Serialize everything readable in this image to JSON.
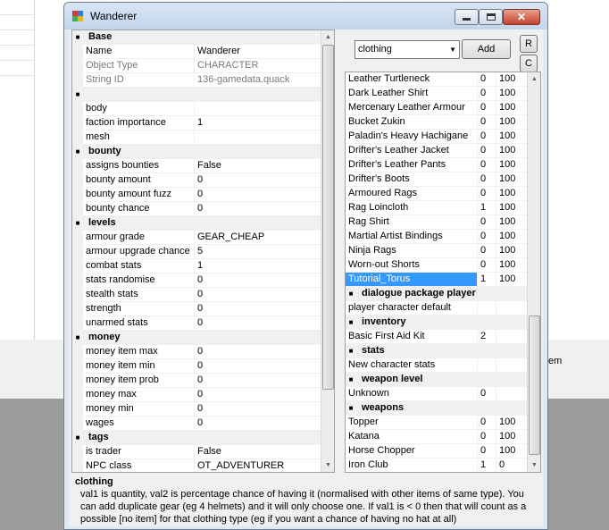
{
  "background": {
    "side_label": "em"
  },
  "window": {
    "title": "Wanderer"
  },
  "colors": {
    "title_bar": "#c3d5ec",
    "selection": "#3399ff",
    "category_bg": "#f0f0f0",
    "close_button": "#c3442e"
  },
  "properties": [
    {
      "cat": "Base"
    },
    {
      "k": "Name",
      "v": "Wanderer"
    },
    {
      "k": "Object Type",
      "v": "CHARACTER",
      "ro": true
    },
    {
      "k": "String ID",
      "v": "136-gamedata.quack",
      "ro": true
    },
    {
      "cat": ""
    },
    {
      "k": "body",
      "v": ""
    },
    {
      "k": "faction importance",
      "v": "1"
    },
    {
      "k": "mesh",
      "v": ""
    },
    {
      "cat": "bounty"
    },
    {
      "k": "assigns bounties",
      "v": "False"
    },
    {
      "k": "bounty amount",
      "v": "0"
    },
    {
      "k": "bounty amount fuzz",
      "v": "0"
    },
    {
      "k": "bounty chance",
      "v": "0"
    },
    {
      "cat": "levels"
    },
    {
      "k": "armour grade",
      "v": "GEAR_CHEAP"
    },
    {
      "k": "armour upgrade chance",
      "v": "5"
    },
    {
      "k": "combat stats",
      "v": "1"
    },
    {
      "k": "stats randomise",
      "v": "0"
    },
    {
      "k": "stealth stats",
      "v": "0"
    },
    {
      "k": "strength",
      "v": "0"
    },
    {
      "k": "unarmed stats",
      "v": "0"
    },
    {
      "cat": "money"
    },
    {
      "k": "money item max",
      "v": "0"
    },
    {
      "k": "money item min",
      "v": "0"
    },
    {
      "k": "money item prob",
      "v": "0"
    },
    {
      "k": "money max",
      "v": "0"
    },
    {
      "k": "money min",
      "v": "0"
    },
    {
      "k": "wages",
      "v": "0"
    },
    {
      "cat": "tags"
    },
    {
      "k": "is trader",
      "v": "False"
    },
    {
      "k": "NPC class",
      "v": "OT_ADVENTURER"
    }
  ],
  "references": {
    "category_select": "clothing",
    "add_label": "Add",
    "r_label": "R",
    "c_label": "C",
    "rows": [
      {
        "k": "Leather Turtleneck",
        "a": "0",
        "b": "100"
      },
      {
        "k": "Dark Leather Shirt",
        "a": "0",
        "b": "100"
      },
      {
        "k": "Mercenary Leather Armour",
        "a": "0",
        "b": "100"
      },
      {
        "k": "Bucket Zukin",
        "a": "0",
        "b": "100"
      },
      {
        "k": "Paladin's Heavy Hachigane",
        "a": "0",
        "b": "100"
      },
      {
        "k": "Drifter's Leather Jacket",
        "a": "0",
        "b": "100"
      },
      {
        "k": "Drifter's Leather Pants",
        "a": "0",
        "b": "100"
      },
      {
        "k": "Drifter's Boots",
        "a": "0",
        "b": "100"
      },
      {
        "k": "Armoured Rags",
        "a": "0",
        "b": "100"
      },
      {
        "k": "Rag Loincloth",
        "a": "1",
        "b": "100"
      },
      {
        "k": "Rag Shirt",
        "a": "0",
        "b": "100"
      },
      {
        "k": "Martial Artist Bindings",
        "a": "0",
        "b": "100"
      },
      {
        "k": "Ninja Rags",
        "a": "0",
        "b": "100"
      },
      {
        "k": "Worn-out Shorts",
        "a": "0",
        "b": "100"
      },
      {
        "k": "Tutorial_Torus",
        "a": "1",
        "b": "100",
        "selected": true
      },
      {
        "cat": "dialogue package player"
      },
      {
        "k": "player character default",
        "a": "",
        "b": ""
      },
      {
        "cat": "inventory"
      },
      {
        "k": "Basic First Aid Kit",
        "a": "2",
        "b": ""
      },
      {
        "cat": "stats"
      },
      {
        "k": "New character stats",
        "a": "",
        "b": ""
      },
      {
        "cat": "weapon level"
      },
      {
        "k": "Unknown",
        "a": "0",
        "b": ""
      },
      {
        "cat": "weapons"
      },
      {
        "k": "Topper",
        "a": "0",
        "b": "100"
      },
      {
        "k": "Katana",
        "a": "0",
        "b": "100"
      },
      {
        "k": "Horse Chopper",
        "a": "0",
        "b": "100"
      },
      {
        "k": "Iron Club",
        "a": "1",
        "b": "0"
      }
    ]
  },
  "help": {
    "title": "clothing",
    "description": "val1 is quantity, val2 is percentage chance of having it (normalised with other items of same type).  You can add duplicate gear (eg 4 helmets) and it will only choose one.  If val1 is < 0 then that will count as a possible [no item] for that clothing type (eg if you want a chance of having no hat at all)"
  }
}
